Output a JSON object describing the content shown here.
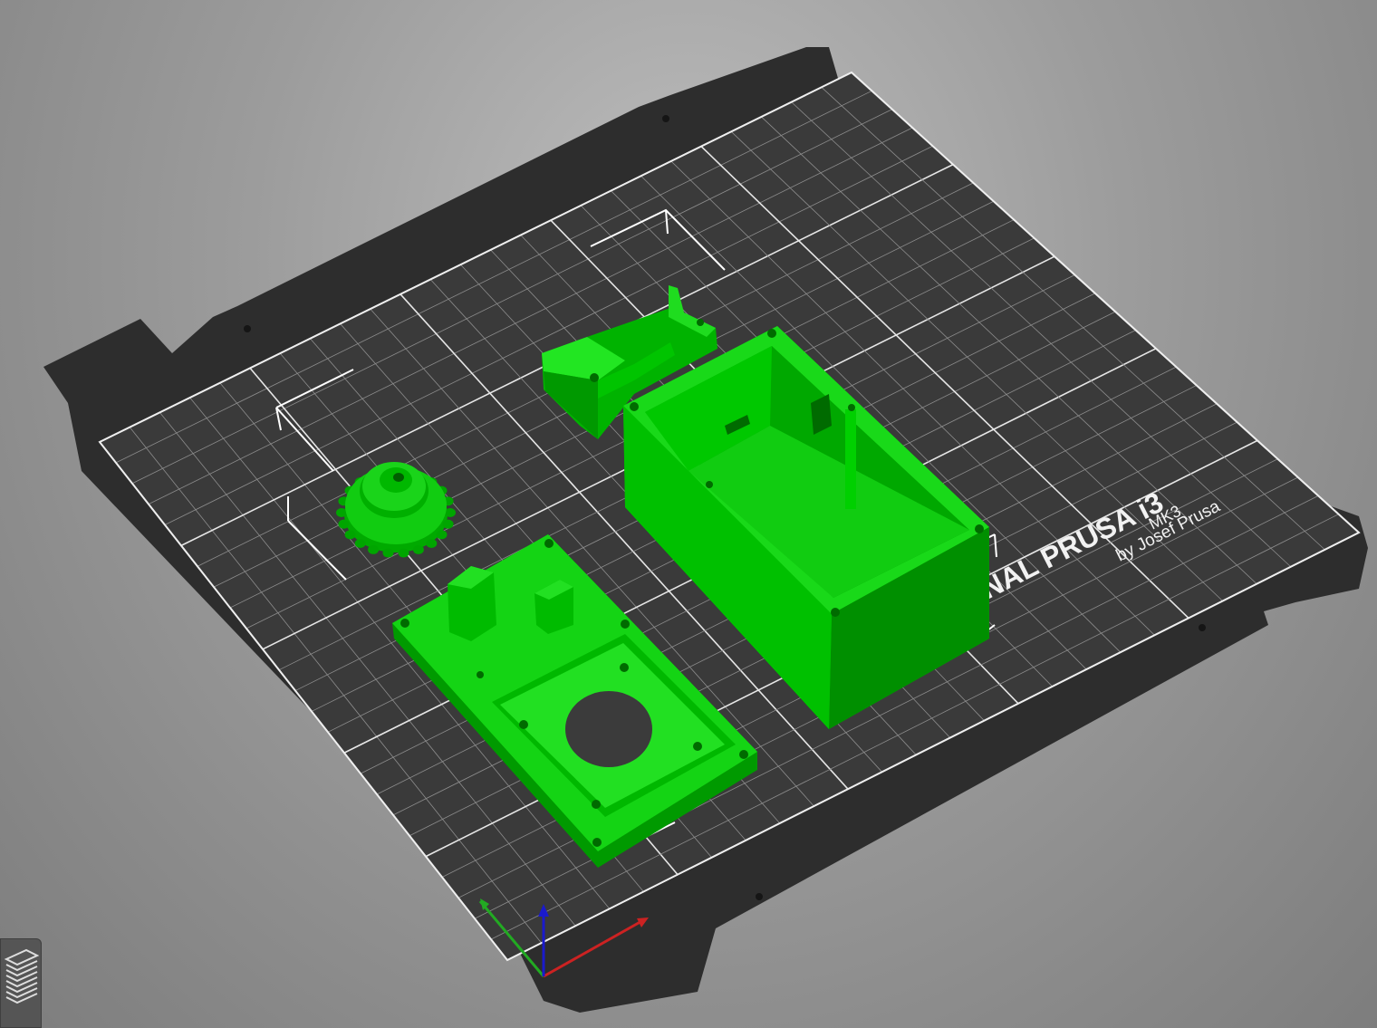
{
  "bed": {
    "brand_text": "NAL PRUSA i3",
    "model_text": "MK3",
    "author_text": "by Josef Prusa"
  },
  "objects": [
    {
      "name": "idler-bracket"
    },
    {
      "name": "enclosure-box"
    },
    {
      "name": "pulley-gear"
    },
    {
      "name": "motor-mount-plate"
    }
  ],
  "axes": {
    "x": "red",
    "y": "green",
    "z": "blue"
  },
  "colors": {
    "background": "#9c9c9c",
    "bed": "#3a3a3a",
    "bed_frame": "#2b2b2b",
    "grid": "#d0d0d0",
    "model": "#00cc00",
    "model_dark": "#009a00",
    "x_axis": "#cc2222",
    "y_axis": "#22aa22",
    "z_axis": "#1a1acc"
  },
  "toolbar": {
    "layers_icon": "layers-icon"
  }
}
